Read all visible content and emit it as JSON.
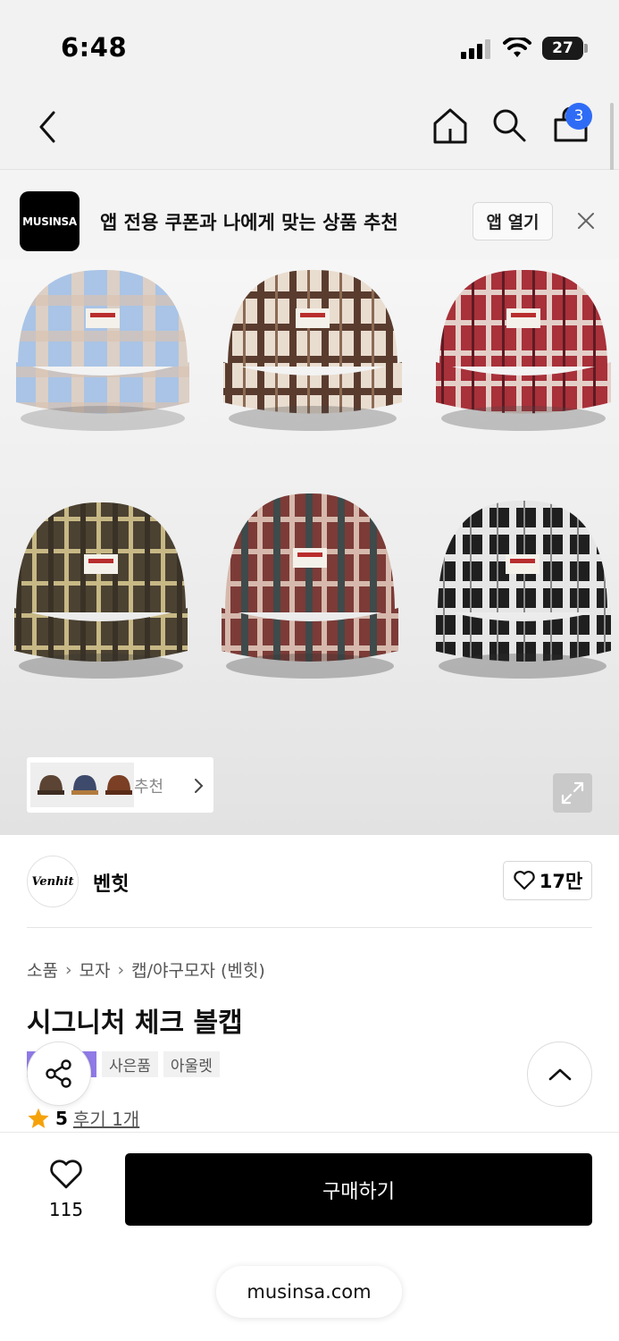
{
  "status_bar": {
    "time": "6:48",
    "battery": "27"
  },
  "nav": {
    "cart_count": "3",
    "icons": [
      "back-icon",
      "home-icon",
      "search-icon",
      "bag-icon"
    ]
  },
  "banner": {
    "logo_text": "MUSINSA",
    "text": "앱 전용 쿠폰과 나에게 맞는 상품 추천",
    "open_label": "앱 열기"
  },
  "product_image": {
    "related_label": "추천"
  },
  "brand": {
    "logo_text": "Venhit",
    "name": "벤힛",
    "like_count": "17만"
  },
  "breadcrumb": [
    "소품",
    "모자",
    "캡/야구모자 (벤힛)"
  ],
  "product": {
    "title": "시그니처 체크 볼캡",
    "tags": [
      "사은품",
      "아울렛"
    ],
    "rating": "5",
    "reviews": "후기 1개"
  },
  "bottom": {
    "wish_count": "115",
    "buy_label": "구매하기",
    "url": "musinsa.com"
  },
  "colors": {
    "accent_blue": "#2f6cf6",
    "tag_purple": "#8f7ae6",
    "star": "#f5a20a"
  }
}
